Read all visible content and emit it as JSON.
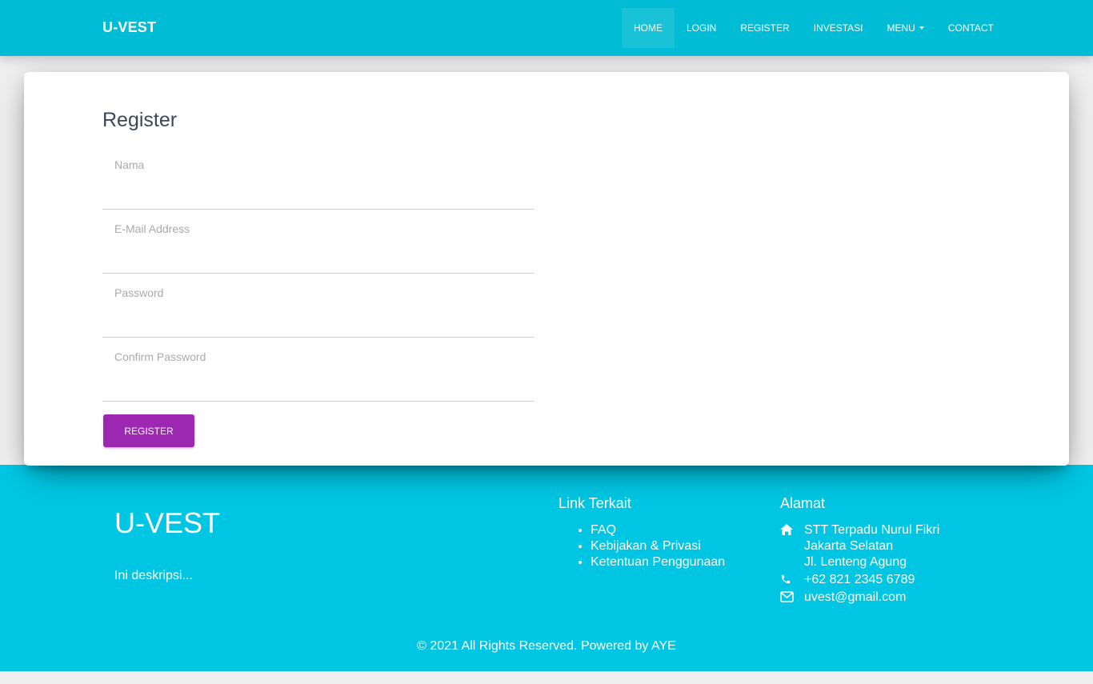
{
  "navbar": {
    "brand": "U-VEST",
    "items": [
      {
        "label": "HOME"
      },
      {
        "label": "LOGIN"
      },
      {
        "label": "REGISTER"
      },
      {
        "label": "INVESTASI"
      },
      {
        "label": "MENU"
      },
      {
        "label": "CONTACT"
      }
    ],
    "active_item": "HOME"
  },
  "form": {
    "title": "Register",
    "fields": [
      {
        "label": "Nama",
        "value": ""
      },
      {
        "label": "E-Mail Address",
        "value": ""
      },
      {
        "label": "Password",
        "value": ""
      },
      {
        "label": "Confirm Password",
        "value": ""
      }
    ],
    "submit_label": "REGISTER"
  },
  "footer": {
    "brand": "U-VEST",
    "description": "Ini deskripsi...",
    "links_title": "Link Terkait",
    "links": [
      "FAQ",
      "Kebijakan & Privasi",
      "Ketentuan Penggunaan"
    ],
    "address_title": "Alamat",
    "address_lines": [
      "STT Terpadu Nurul Fikri",
      "Jakarta Selatan",
      "Jl. Lenteng Agung"
    ],
    "phone": "+62 821 2345 6789",
    "email": "uvest@gmail.com",
    "copyright": "© 2021 All Rights Reserved. Powered by AYE"
  },
  "colors": {
    "navbar_bg": "#00bcd4",
    "footer_bg": "#00c6e3",
    "button_bg": "#9c27b0",
    "page_bg": "#eeeeee"
  },
  "icons": {
    "address": "home-icon",
    "phone": "phone-icon",
    "email": "envelope-icon",
    "menu_dropdown": "caret-down-icon"
  }
}
